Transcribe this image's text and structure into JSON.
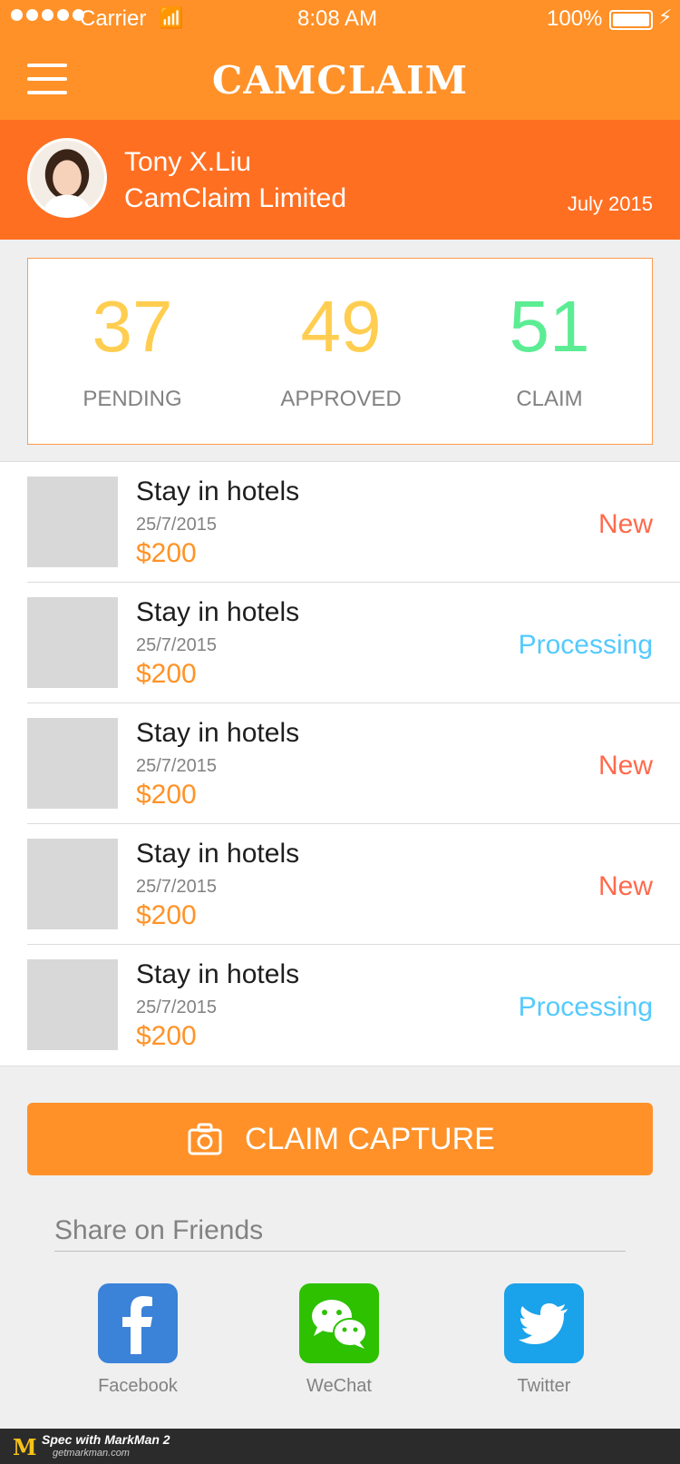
{
  "status_bar": {
    "carrier": "Carrier",
    "time": "8:08 AM",
    "battery": "100%"
  },
  "nav": {
    "logo": "CAMCLAIM"
  },
  "profile": {
    "name": "Tony X.Liu",
    "company": "CamClaim Limited",
    "date": "July  2015"
  },
  "stats": [
    {
      "value": "37",
      "label": "PENDING",
      "color": "#ffce51"
    },
    {
      "value": "49",
      "label": "APPROVED",
      "color": "#ffce51"
    },
    {
      "value": "51",
      "label": "CLAIM",
      "color": "#5ced94"
    }
  ],
  "claims": [
    {
      "title": "Stay in hotels",
      "date": "25/7/2015",
      "amount": "$200",
      "status": "New",
      "status_color": "#ff6a4c"
    },
    {
      "title": "Stay in hotels",
      "date": "25/7/2015",
      "amount": "$200",
      "status": "Processing",
      "status_color": "#54cafd"
    },
    {
      "title": "Stay in hotels",
      "date": "25/7/2015",
      "amount": "$200",
      "status": "New",
      "status_color": "#ff6a4c"
    },
    {
      "title": "Stay in hotels",
      "date": "25/7/2015",
      "amount": "$200",
      "status": "New",
      "status_color": "#ff6a4c"
    },
    {
      "title": "Stay in hotels",
      "date": "25/7/2015",
      "amount": "$200",
      "status": "Processing",
      "status_color": "#54cafd"
    }
  ],
  "claim_button": {
    "label": "CLAIM CAPTURE",
    "icon": "camera-icon"
  },
  "share": {
    "title": "Share on Friends",
    "items": [
      {
        "name": "Facebook",
        "icon": "facebook-icon",
        "color": "#3b82d9"
      },
      {
        "name": "WeChat",
        "icon": "wechat-icon",
        "color": "#2dc100"
      },
      {
        "name": "Twitter",
        "icon": "twitter-icon",
        "color": "#1aa2ea"
      }
    ]
  },
  "footer": {
    "brand": "Spec with MarkMan 2",
    "url": "getmarkman.com"
  }
}
